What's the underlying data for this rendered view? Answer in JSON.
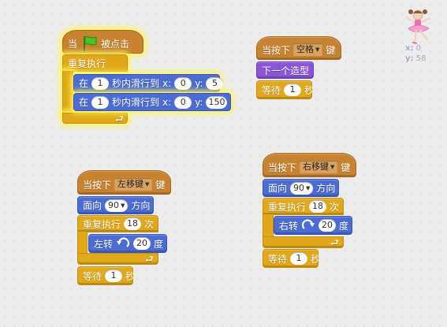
{
  "sprite": {
    "x_label": "x:",
    "x_value": "0",
    "y_label": "y:",
    "y_value": "58",
    "costume_icon": "ballerina-sprite"
  },
  "script1": {
    "hat_when": "当",
    "hat_clicked": "被点击",
    "flag_icon": "green-flag",
    "repeat_forever": "重复执行",
    "glide1": {
      "prefix": "在",
      "secs": "1",
      "mid": "秒内滑行到",
      "x_label": "x:",
      "x": "0",
      "y_label": "y:",
      "y": "5"
    },
    "glide2": {
      "prefix": "在",
      "secs": "1",
      "mid": "秒内滑行到",
      "x_label": "x:",
      "x": "0",
      "y_label": "y:",
      "y": "150"
    }
  },
  "script2": {
    "hat_prefix": "当按下",
    "key": "空格",
    "hat_suffix": "键",
    "next_costume": "下一个造型",
    "wait": {
      "prefix": "等待",
      "secs": "1",
      "suffix": "秒"
    }
  },
  "script3": {
    "hat_prefix": "当按下",
    "key": "左移键",
    "hat_suffix": "键",
    "point": {
      "prefix": "面向",
      "dir": "90",
      "suffix": "方向"
    },
    "repeat": {
      "prefix": "重复执行",
      "times": "18",
      "suffix": "次"
    },
    "turn": {
      "prefix": "左转",
      "deg": "20",
      "suffix": "度",
      "icon": "rotate-left"
    },
    "wait": {
      "prefix": "等待",
      "secs": "1",
      "suffix": "秒"
    }
  },
  "script4": {
    "hat_prefix": "当按下",
    "key": "右移键",
    "hat_suffix": "键",
    "point": {
      "prefix": "面向",
      "dir": "90",
      "suffix": "方向"
    },
    "repeat": {
      "prefix": "重复执行",
      "times": "18",
      "suffix": "次"
    },
    "turn": {
      "prefix": "右转",
      "deg": "20",
      "suffix": "度",
      "icon": "rotate-right"
    },
    "wait": {
      "prefix": "等待",
      "secs": "1",
      "suffix": "秒"
    }
  },
  "colors": {
    "control": "#e1a91a",
    "events": "#c88330",
    "motion": "#4a6cd4",
    "looks": "#8a55d7",
    "highlight": "#fff65a"
  }
}
